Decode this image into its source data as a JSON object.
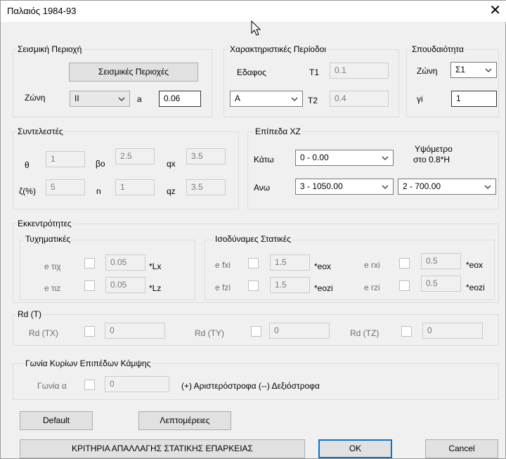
{
  "window": {
    "title": "Παλαιός 1984-93"
  },
  "seismic_area": {
    "label": "Σεισμική Περιοχή",
    "button": "Σεισμικές Περιοχές",
    "zone_label": "Ζώνη",
    "zone_value": "II",
    "a_label": "a",
    "a_value": "0.06"
  },
  "periods": {
    "label": "Χαρακτηριστικές Περίοδοι",
    "soil_label": "Εδαφος",
    "soil_value": "A",
    "t1_label": "T1",
    "t1_value": "0.1",
    "t2_label": "T2",
    "t2_value": "0.4"
  },
  "importance": {
    "label": "Σπουδαιότητα",
    "zone_label": "Ζώνη",
    "zone_value": "Σ1",
    "gi_label": "γi",
    "gi_value": "1"
  },
  "coefficients": {
    "label": "Συντελεστές",
    "theta_label": "θ",
    "theta_value": "1",
    "bo_label": "βο",
    "bo_value": "2.5",
    "qx_label": "qx",
    "qx_value": "3.5",
    "zeta_label": "ζ(%)",
    "zeta_value": "5",
    "n_label": "n",
    "n_value": "1",
    "qz_label": "qz",
    "qz_value": "3.5"
  },
  "levels": {
    "label": "Επίπεδα XZ",
    "bottom_label": "Κάτω",
    "bottom_value": "0 - 0.00",
    "top_label": "Ανω",
    "top_value": "3 - 1050.00",
    "height_label_1": "Υψόμετρο",
    "height_label_2": "στο 0.8*Η",
    "height_value": "2 - 700.00"
  },
  "eccentricities": {
    "label": "Εκκεντρότητες",
    "accidental": {
      "label": "Τυχηματικές",
      "etix_label": "e τιχ",
      "etix_value": "0.05",
      "etix_suffix": "*Lx",
      "etiz_label": "e τιz",
      "etiz_value": "0.05",
      "etiz_suffix": "*Lz"
    },
    "static": {
      "label": "Ισοδύναμες Στατικές",
      "efxi_label": "e fxi",
      "efxi_value": "1.5",
      "efxi_suffix": "*eox",
      "efzi_label": "e fzi",
      "efzi_value": "1.5",
      "efzi_suffix": "*eozi",
      "erxi_label": "e rxi",
      "erxi_value": "0.5",
      "erxi_suffix": "*eox",
      "erzi_label": "e rzi",
      "erzi_value": "0.5",
      "erzi_suffix": "*eozi"
    }
  },
  "rd": {
    "label": "Rd (T)",
    "tx_label": "Rd (TX)",
    "tx_value": "0",
    "ty_label": "Rd (TY)",
    "ty_value": "0",
    "tz_label": "Rd (TZ)",
    "tz_value": "0"
  },
  "bending": {
    "label": "Γωνία Κυρίων Επιπέδων Κάμψης",
    "angle_label": "Γωνία α",
    "angle_value": "0",
    "note": "(+) Αριστερόστροφα (--) Δεξιόστροφα"
  },
  "buttons": {
    "default": "Default",
    "details": "Λεπτομέρειες",
    "criteria": "ΚΡΙΤΗΡΙΑ ΑΠΑΛΛΑΓΗΣ ΣΤΑΤΙΚΗΣ ΕΠΑΡΚΕΙΑΣ",
    "ok": "OK",
    "cancel": "Cancel"
  }
}
